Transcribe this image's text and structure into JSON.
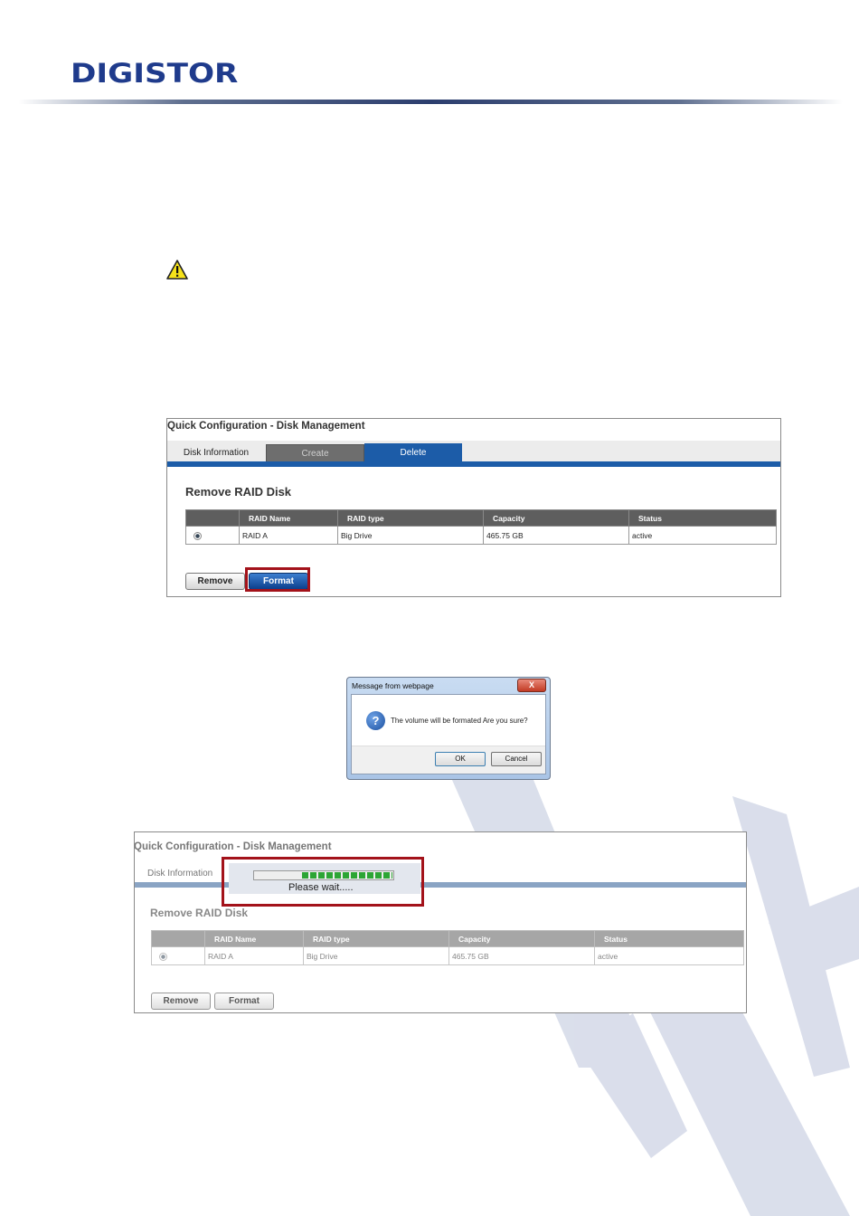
{
  "header": {
    "logo_text": "DIGISTOR"
  },
  "colors": {
    "brand": "#1f3b8c",
    "tab_active": "#1c5ca8",
    "highlight": "#a3121a",
    "progress": "#2da534"
  },
  "panel1": {
    "title": "Quick Configuration - Disk Management",
    "tabs": [
      {
        "label": "Disk Information"
      },
      {
        "label": "Create"
      },
      {
        "label": "Delete"
      }
    ],
    "section_title": "Remove RAID Disk",
    "table": {
      "columns": [
        "",
        "RAID Name",
        "RAID type",
        "Capacity",
        "Status"
      ],
      "rows": [
        [
          "",
          "RAID A",
          "Big Drive",
          "465.75 GB",
          "active"
        ]
      ]
    },
    "buttons": {
      "remove": "Remove",
      "format": "Format"
    }
  },
  "dialog": {
    "title": "Message from webpage",
    "close": "X",
    "icon": "question-icon",
    "message": "The volume will be formated Are you sure?",
    "ok": "OK",
    "cancel": "Cancel"
  },
  "panel2": {
    "title": "Quick Configuration - Disk Management",
    "tab_info": "Disk Information",
    "progress_fraction": 0.65,
    "wait_text": "Please wait.....",
    "section_title": "Remove RAID Disk",
    "table": {
      "columns": [
        "",
        "RAID Name",
        "RAID type",
        "Capacity",
        "Status"
      ],
      "rows": [
        [
          "",
          "RAID A",
          "Big Drive",
          "465.75 GB",
          "active"
        ]
      ]
    },
    "buttons": {
      "remove": "Remove",
      "format": "Format"
    }
  }
}
